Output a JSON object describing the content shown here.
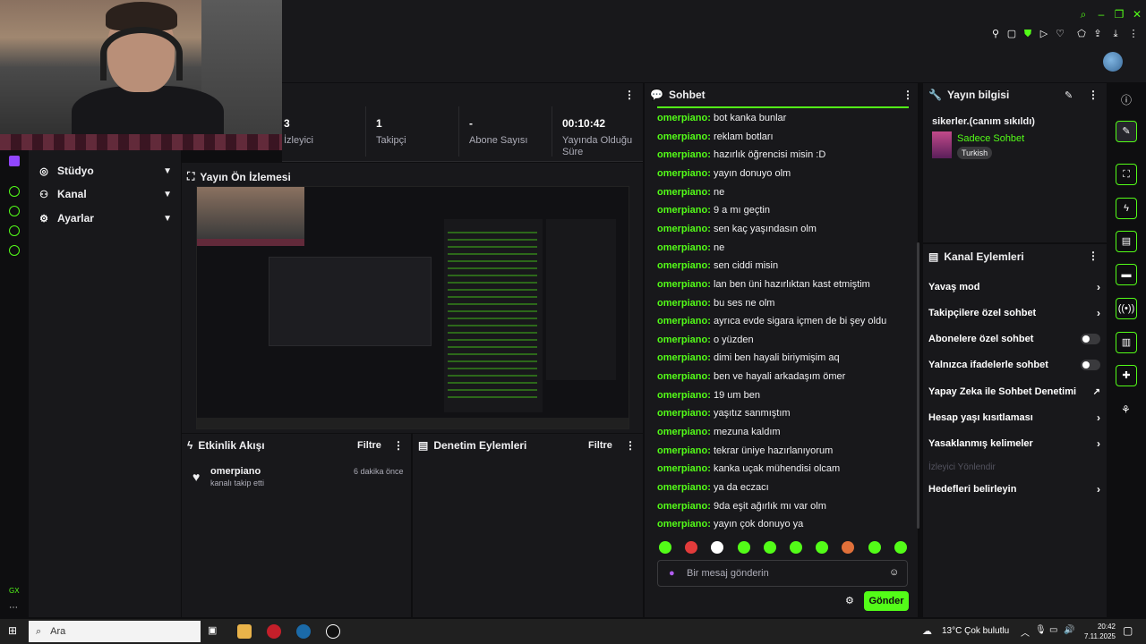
{
  "stats": [
    {
      "value": "3",
      "label": "İzleyici"
    },
    {
      "value": "1",
      "label": "Takipçi"
    },
    {
      "value": "-",
      "label": "Abone Sayısı"
    },
    {
      "value": "00:10:42",
      "label": "Yayında Olduğu Süre"
    }
  ],
  "nav": {
    "items": [
      {
        "label": "Stüdyo",
        "icon": "studio-icon"
      },
      {
        "label": "Kanal",
        "icon": "channel-icon"
      },
      {
        "label": "Ayarlar",
        "icon": "gear-icon"
      }
    ]
  },
  "preview": {
    "title": "Yayın Ön İzlemesi"
  },
  "activity": {
    "title": "Etkinlik Akışı",
    "filter": "Filtre",
    "event": {
      "user": "omerpiano",
      "text": "kanalı takip etti",
      "time": "6 dakika önce"
    }
  },
  "moderation": {
    "title": "Denetim Eylemleri",
    "filter": "Filtre"
  },
  "chat": {
    "title": "Sohbet",
    "messages": [
      {
        "user": "omerpiano:",
        "text": "bot kanka bunlar"
      },
      {
        "user": "omerpiano:",
        "text": "reklam botları"
      },
      {
        "user": "omerpiano:",
        "text": "hazırlık öğrencisi misin :D"
      },
      {
        "user": "omerpiano:",
        "text": "yayın donuyo olm"
      },
      {
        "user": "omerpiano:",
        "text": "ne"
      },
      {
        "user": "omerpiano:",
        "text": "9 a mı geçtin"
      },
      {
        "user": "omerpiano:",
        "text": "sen kaç yaşındasın olm"
      },
      {
        "user": "omerpiano:",
        "text": "ne"
      },
      {
        "user": "omerpiano:",
        "text": "sen ciddi misin"
      },
      {
        "user": "omerpiano:",
        "text": "lan ben üni hazırlıktan kast etmiştim"
      },
      {
        "user": "omerpiano:",
        "text": "bu ses ne olm"
      },
      {
        "user": "omerpiano:",
        "text": "ayrıca evde sigara içmen de bi şey oldu"
      },
      {
        "user": "omerpiano:",
        "text": "o yüzden"
      },
      {
        "user": "omerpiano:",
        "text": "dimi ben hayali biriymişim aq"
      },
      {
        "user": "omerpiano:",
        "text": "ben ve hayali arkadaşım ömer"
      },
      {
        "user": "omerpiano:",
        "text": "19 um ben"
      },
      {
        "user": "omerpiano:",
        "text": "yaşıtız sanmıştım"
      },
      {
        "user": "omerpiano:",
        "text": "mezuna kaldım"
      },
      {
        "user": "omerpiano:",
        "text": "tekrar üniye hazırlanıyorum"
      },
      {
        "user": "omerpiano:",
        "text": "kanka uçak mühendisi olcam"
      },
      {
        "user": "omerpiano:",
        "text": "ya da eczacı"
      },
      {
        "user": "omerpiano:",
        "text": "9da eşit ağırlık mı var olm"
      },
      {
        "user": "omerpiano:",
        "text": "yayın çok donuyo ya"
      }
    ],
    "placeholder": "Bir mesaj gönderin",
    "send": "Gönder"
  },
  "streaminfo": {
    "title": "Yayın bilgisi",
    "stream_title": "sikerler.(canım sıkıldı)",
    "category": "Sadece Sohbet",
    "tag": "Turkish"
  },
  "actions": {
    "title": "Kanal Eylemleri",
    "items": [
      {
        "label": "Yavaş mod",
        "type": "chevron"
      },
      {
        "label": "Takipçilere özel sohbet",
        "type": "chevron"
      },
      {
        "label": "Abonelere özel sohbet",
        "type": "toggle"
      },
      {
        "label": "Yalnızca ifadelerle sohbet",
        "type": "toggle"
      },
      {
        "label": "Yapay Zeka ile Sohbet Denetimi",
        "type": "external"
      },
      {
        "label": "Hesap yaşı kısıtlaması",
        "type": "chevron"
      },
      {
        "label": "Yasaklanmış kelimeler",
        "type": "chevron"
      },
      {
        "label": "İzleyici Yönlendir",
        "type": "disabled"
      },
      {
        "label": "Hedefleri belirleyin",
        "type": "chevron"
      }
    ]
  },
  "taskbar": {
    "search": "Ara",
    "weather": "13°C  Çok bulutlu",
    "time": "20:42",
    "date": "7.11.2025"
  },
  "colors": {
    "accent": "#53fc18",
    "bg": "#0e0e10",
    "panel": "#18181b"
  }
}
